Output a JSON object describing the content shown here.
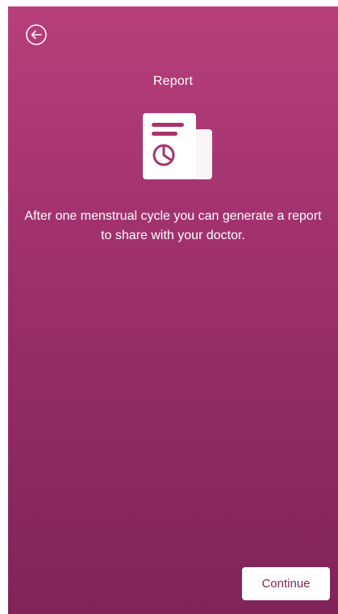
{
  "header": {
    "back_icon": "back-arrow-circle-icon",
    "title": "Report"
  },
  "main": {
    "illustration_icon": "report-document-pie-chart-icon",
    "description": "After one menstrual cycle you can generate a report to share with your doctor."
  },
  "footer": {
    "continue_label": "Continue"
  },
  "colors": {
    "gradient_top": "#b73f7b",
    "gradient_bottom": "#7f2359",
    "button_background": "#ffffff",
    "button_text": "#7a2a5a",
    "text": "#ffffff"
  }
}
